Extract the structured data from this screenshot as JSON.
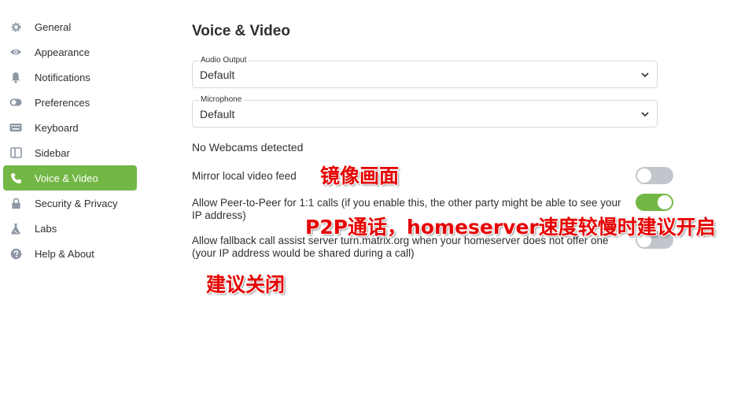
{
  "sidebar": {
    "items": [
      {
        "label": "General",
        "icon": "gear-icon"
      },
      {
        "label": "Appearance",
        "icon": "eye-icon"
      },
      {
        "label": "Notifications",
        "icon": "bell-icon"
      },
      {
        "label": "Preferences",
        "icon": "toggle-icon"
      },
      {
        "label": "Keyboard",
        "icon": "keyboard-icon"
      },
      {
        "label": "Sidebar",
        "icon": "sidebar-icon"
      },
      {
        "label": "Voice & Video",
        "icon": "phone-icon",
        "active": true
      },
      {
        "label": "Security & Privacy",
        "icon": "lock-icon"
      },
      {
        "label": "Labs",
        "icon": "flask-icon"
      },
      {
        "label": "Help & About",
        "icon": "help-icon"
      }
    ]
  },
  "main": {
    "title": "Voice & Video",
    "audio_output": {
      "label": "Audio Output",
      "value": "Default"
    },
    "microphone": {
      "label": "Microphone",
      "value": "Default"
    },
    "no_webcams": "No Webcams detected",
    "settings": [
      {
        "label": "Mirror local video feed",
        "enabled": false
      },
      {
        "label": "Allow Peer-to-Peer for 1:1 calls (if you enable this, the other party might be able to see your IP address)",
        "enabled": true
      },
      {
        "label": "Allow fallback call assist server turn.matrix.org when your homeserver does not offer one (your IP address would be shared during a call)",
        "enabled": false
      }
    ]
  },
  "annotations": {
    "mirror": "镜像画面",
    "p2p": "P2P通话，homeserver速度较慢时建议开启",
    "fallback": "建议关闭"
  },
  "colors": {
    "accent": "#73b746",
    "toggle_off": "#c1c6cd",
    "annotation": "#e60000"
  }
}
